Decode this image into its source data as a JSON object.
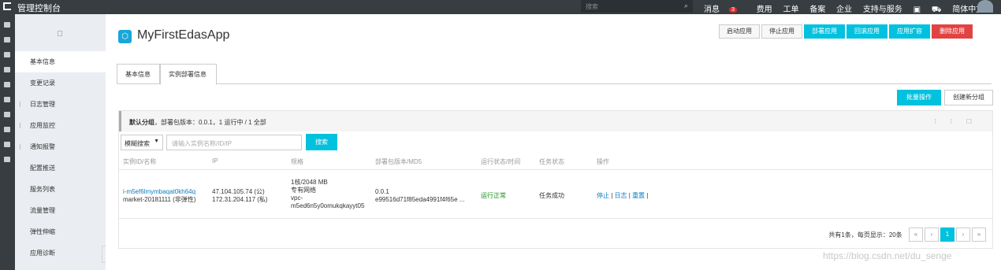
{
  "topbar": {
    "brand": "管理控制台",
    "search_placeholder": "搜索",
    "nav": {
      "messages": "消息",
      "badge": "3",
      "billing": "费用",
      "tickets": "工单",
      "icp": "备案",
      "enterprise": "企业",
      "support": "支持与服务",
      "language": "简体中文"
    }
  },
  "sidebar": {
    "items": [
      "基本信息",
      "变更记录",
      "日志管理",
      "应用监控",
      "通知报警",
      "配置推送",
      "服务列表",
      "流量管理",
      "弹性伸缩",
      "应用诊断"
    ]
  },
  "app": {
    "title": "MyFirstEdasApp",
    "actions": {
      "start": "启动应用",
      "stop": "停止应用",
      "deploy": "部署应用",
      "rollback": "回滚应用",
      "scale": "应用扩容",
      "delete": "删除应用"
    }
  },
  "tabs": [
    "基本信息",
    "实例部署信息"
  ],
  "toolbar": {
    "batch": "批量操作",
    "create_group": "创建新分组"
  },
  "group": {
    "name": "默认分组",
    "summary": "，部署包版本：0.0.1，1 运行中 / 1 全部",
    "filter": {
      "selected": "模糊搜索",
      "placeholder": "请输入实例名称/ID/IP",
      "search": "搜索"
    }
  },
  "table": {
    "headers": [
      "实例ID/名称",
      "IP",
      "规格",
      "部署包版本/MD5",
      "运行状态/时间",
      "任务状态",
      "操作"
    ],
    "rows": [
      {
        "id": "i-m5ef6lmymbaqat0kh64q",
        "name": "market-20181111 (非弹性)",
        "ip_public": "47.104.105.74 (公)",
        "ip_private": "172.31.204.117 (私)",
        "spec1": "1核/2048 MB",
        "spec2": "专有网络",
        "spec3": "vpc-",
        "spec4": "m5ed6n5y0omukqkayyt05",
        "version": "0.0.1",
        "md5": "e99516d71f85eda4991f4f65e ...",
        "run_status": "运行正常",
        "task_status": "任务成功",
        "op_stop": "停止",
        "op_log": "日志",
        "op_restart": "重置"
      }
    ]
  },
  "pager": {
    "summary": "共有1条，每页显示：20条",
    "first": "«",
    "prev": "‹",
    "current": "1",
    "next": "›",
    "last": "»"
  },
  "watermark": "https://blog.csdn.net/du_senge"
}
